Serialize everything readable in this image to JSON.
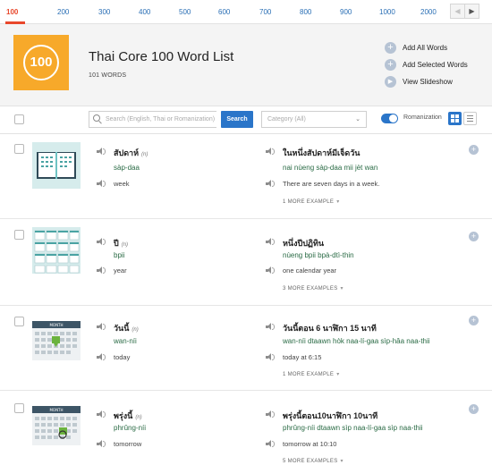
{
  "tabs": [
    "100",
    "200",
    "300",
    "400",
    "500",
    "600",
    "700",
    "800",
    "900",
    "1000",
    "2000"
  ],
  "pager": {
    "prev": "◀",
    "next": "▶"
  },
  "header": {
    "logo_text": "100",
    "title": "Thai Core 100 Word List",
    "word_count": "101 WORDS",
    "actions": [
      "Add All Words",
      "Add Selected Words",
      "View Slideshow"
    ]
  },
  "filter": {
    "search_placeholder": "Search (English, Thai or Romanization)",
    "search_button": "Search",
    "category_placeholder": "Category (All)",
    "category_chevron": "⌄",
    "romanization_label": "Romanization"
  },
  "colors": {
    "accent": "#2a75c9",
    "tab_active": "#e8472b",
    "logo_bg": "#f7a92a",
    "romanization": "#2a6b45"
  },
  "words": [
    {
      "thai": "สัปดาห์",
      "pos": "(n)",
      "romanization": "sàp-daa",
      "english": "week",
      "example_thai": "ในหนึ่งสัปดาห์มีเจ็ดวัน",
      "example_rom": "nai nùeng sàp-daa mii jèt wan",
      "example_eng": "There are seven days in a week.",
      "more": "1 MORE EXAMPLE",
      "icon": "open-book-calendar-icon"
    },
    {
      "thai": "ปี",
      "pos": "(n)",
      "romanization": "bpii",
      "english": "year",
      "example_thai": "หนึ่งปีปฏิทิน",
      "example_rom": "nùeng bpii bpà-dtì-thin",
      "example_eng": "one calendar year",
      "more": "3 MORE EXAMPLES",
      "icon": "year-calendar-icon"
    },
    {
      "thai": "วันนี้",
      "pos": "(n)",
      "romanization": "wan-níi",
      "english": "today",
      "example_thai": "วันนี้ตอน 6 นาฬิกา 15 นาที",
      "example_rom": "wan-níi dtaawn hòk naa-lí-gaa sìp-hâa naa-thii",
      "example_eng": "today at 6:15",
      "more": "1 MORE EXAMPLE",
      "icon": "month-calendar-today-icon"
    },
    {
      "thai": "พรุ่งนี้",
      "pos": "(n)",
      "romanization": "phrûng-níi",
      "english": "tomorrow",
      "example_thai": "พรุ่งนี้ตอน10นาฬิกา 10นาที",
      "example_rom": "phrûng-níi dtaawn sìp naa-lí-gaa sìp naa-thii",
      "example_eng": "tomorrow at 10:10",
      "more": "5 MORE EXAMPLES",
      "icon": "month-calendar-tomorrow-icon"
    }
  ]
}
